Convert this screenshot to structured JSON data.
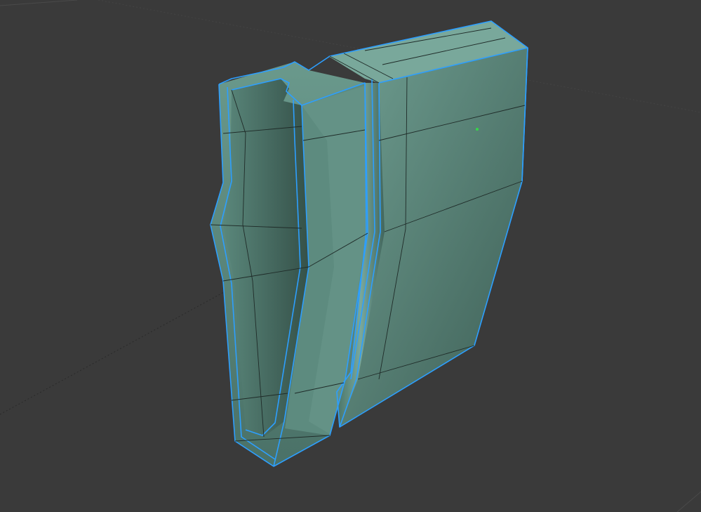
{
  "viewport": {
    "background": "#3a3a3a",
    "grid_line_color": "#5a5a5a",
    "axis_x_color": "#2e2e2e",
    "axis_y_color": "#2e2e2e"
  },
  "mesh": {
    "name": "",
    "mode": "edit",
    "selection": "all-edges",
    "face_color": "#5f8c80",
    "face_shade_color": "#3f5f57",
    "edge_color": "#1c1c1c",
    "selected_edge_color": "#2d9fff",
    "origin_color": "#36d64a"
  }
}
